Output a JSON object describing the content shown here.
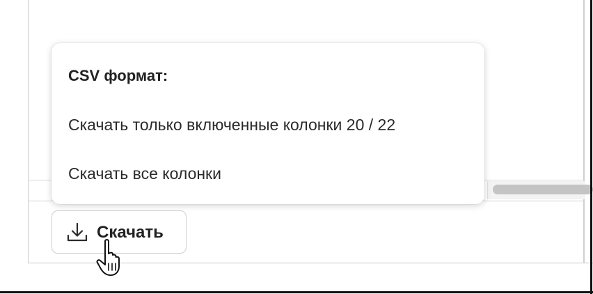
{
  "dropdown": {
    "heading": "CSV формат:",
    "items": [
      {
        "label": "Скачать только включенные колонки 20 / 22"
      },
      {
        "label": "Скачать все колонки"
      }
    ]
  },
  "download_button": {
    "label": "Скачать",
    "icon": "download-icon"
  },
  "cursor": {
    "icon": "hand-pointer-cursor-icon"
  },
  "colors": {
    "text": "#222222",
    "border": "#cfcfcf",
    "scrollbar_thumb": "#c4c4c4",
    "frame": "#111111"
  }
}
